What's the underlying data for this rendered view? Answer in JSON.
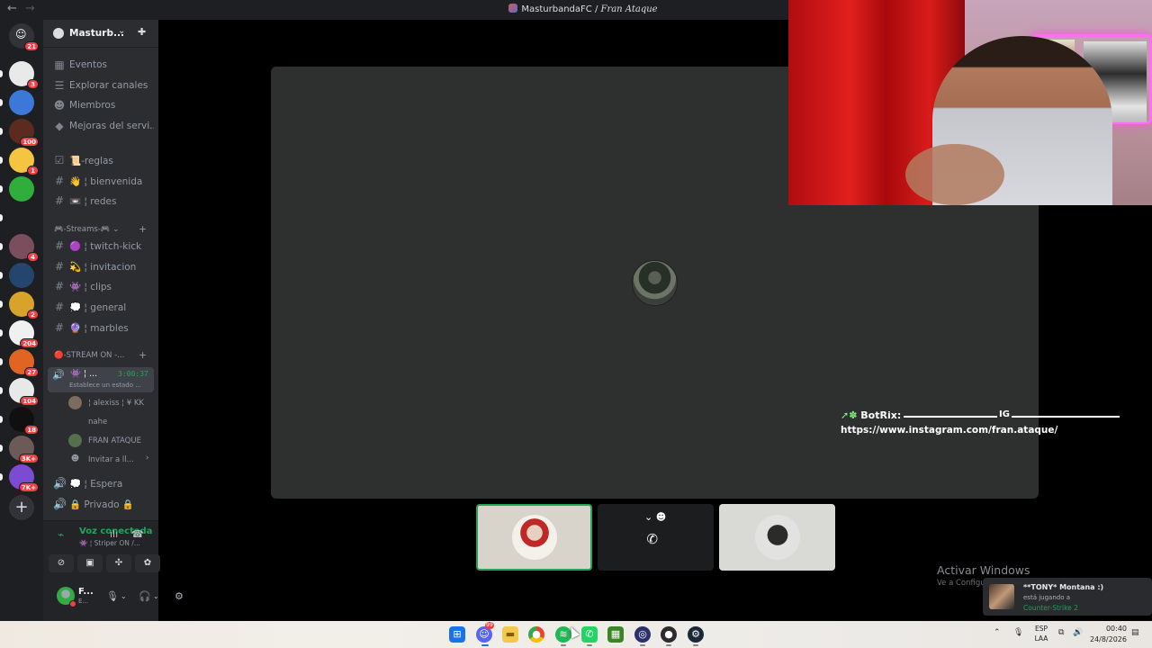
{
  "window": {
    "title_main": "MasturbandaFC / ",
    "title_channel": "Fran Ataque"
  },
  "rail": {
    "dm_badge": "21",
    "servers": [
      {
        "badge": "3",
        "color": "#e9e9e9"
      },
      {
        "badge": "",
        "color": "#3b78d8"
      },
      {
        "badge": "100",
        "color": "#5b2b1f"
      },
      {
        "badge": "1",
        "color": "#f5c542"
      },
      {
        "badge": "",
        "color": "#2fae3c"
      },
      {
        "badge": "",
        "color": "#1e1f22"
      },
      {
        "badge": "4",
        "color": "#7a4e5c"
      },
      {
        "badge": "",
        "color": "#26456e"
      },
      {
        "badge": "2",
        "color": "#d8a32a"
      },
      {
        "badge": "204",
        "color": "#f0f0f0"
      },
      {
        "badge": "27",
        "color": "#e06522"
      },
      {
        "badge": "104",
        "color": "#e8e8e8"
      },
      {
        "badge": "18",
        "color": "#101010"
      },
      {
        "badge": "3K+",
        "color": "#6b5a55"
      },
      {
        "badge": "7K+",
        "color": "#7b4bd1"
      }
    ]
  },
  "server": {
    "name": "Masturb...",
    "menu": [
      {
        "icon": "calendar-icon",
        "glyph": "▦",
        "label": "Eventos"
      },
      {
        "icon": "browse-icon",
        "glyph": "☰",
        "label": "Explorar canales"
      },
      {
        "icon": "members-icon",
        "glyph": "☻",
        "label": "Miembros"
      },
      {
        "icon": "boost-icon",
        "glyph": "◆",
        "label": "Mejoras del servi..."
      }
    ],
    "channels_top": [
      {
        "icon": "rules-icon",
        "glyph": "☑",
        "label": "📜-reglas"
      },
      {
        "icon": "hash-icon",
        "glyph": "#",
        "label": "👋 ¦ bienvenida"
      },
      {
        "icon": "hash-icon",
        "glyph": "#",
        "label": "📼 ¦ redes"
      }
    ],
    "streams_category": "🎮-Streams-🎮",
    "streams_channels": [
      {
        "glyph": "#",
        "label": "🟣 ¦ twitch-kick"
      },
      {
        "glyph": "#",
        "label": "💫 ¦ invitacion"
      },
      {
        "glyph": "#",
        "label": "👾 ¦ clips"
      },
      {
        "glyph": "#",
        "label": "💭 ¦ general"
      },
      {
        "glyph": "#",
        "label": "🔮 ¦ marbles"
      }
    ],
    "stream_on_category": "🔴-STREAM ON -...",
    "active_voice": {
      "label": "👾 ¦ ...",
      "time": "3:00:37",
      "status": "Establece un estado ..."
    },
    "voice_users": [
      {
        "name": "¦ alexiss ¦ ¥ KK",
        "color": "#7a6c5f"
      },
      {
        "name": "nahe",
        "color": ""
      },
      {
        "name": "FRAN ATAQUE",
        "color": "#56704e"
      }
    ],
    "invite_label": "Invitar a ll...",
    "voice_channels": [
      {
        "label": "💭 ¦ Espera"
      },
      {
        "label": "🔒 Privado 🔒"
      }
    ]
  },
  "voice_panel": {
    "status": "Voz conectada",
    "channel": "👾 ¦ Striper ON /..."
  },
  "user_panel": {
    "name": "F...",
    "sub": "E..."
  },
  "stage": {
    "botrix_label": "BotRix:",
    "botrix_ig": "IG",
    "botrix_url": "https://www.instagram.com/fran.ataque/"
  },
  "watermark": {
    "title": "Activar Windows",
    "sub": "Ve a Configuración para activar Windows."
  },
  "toast": {
    "name": "**TONY* Montana :)",
    "playing": "está jugando a",
    "game": "Counter-Strike 2"
  },
  "taskbar": {
    "lang1": "ESP",
    "lang2": "LAA",
    "time": "00:40",
    "date": "24/8/2026",
    "discord_badge": "99"
  },
  "colors": {
    "green": "#23a559",
    "red": "#f23f43",
    "sidebar": "#2b2d31",
    "rail": "#1e1f22"
  }
}
